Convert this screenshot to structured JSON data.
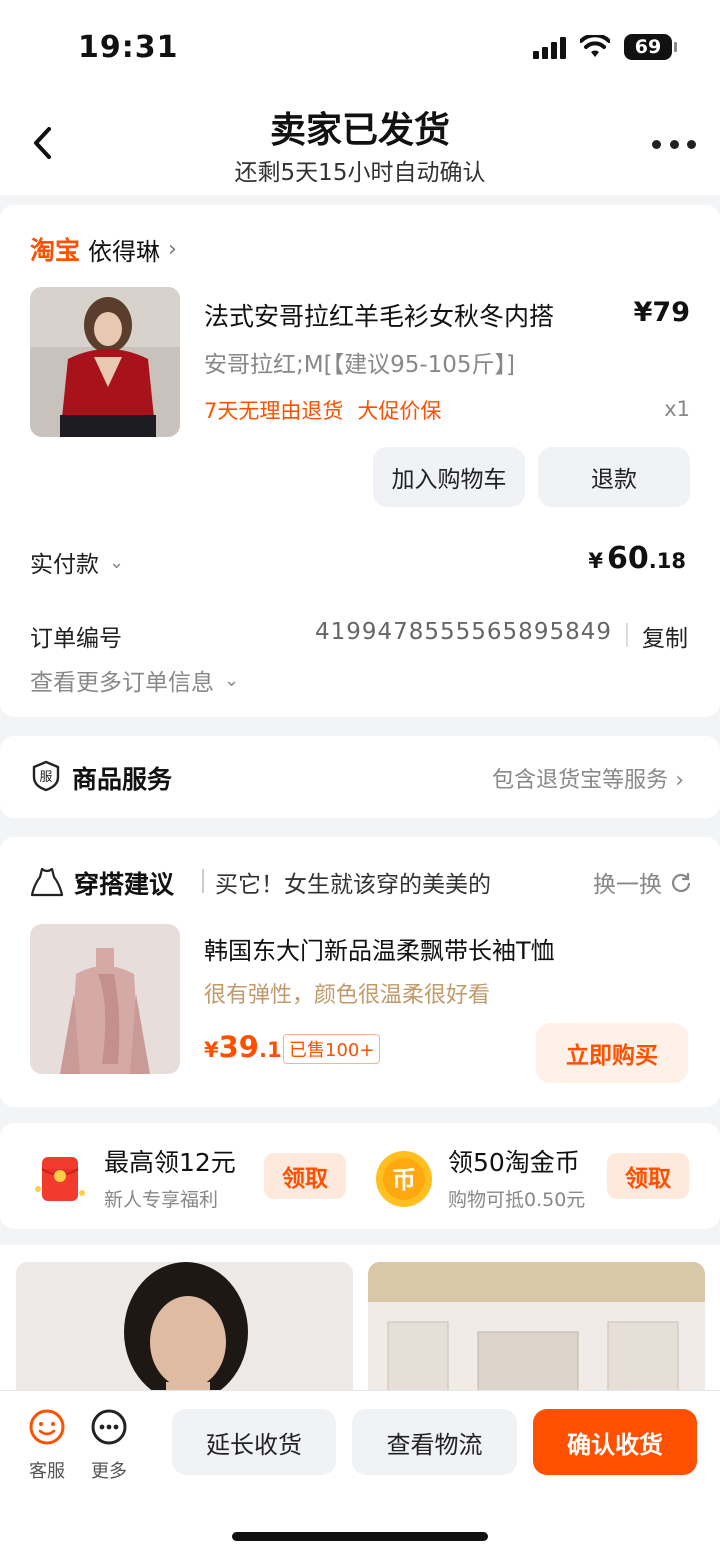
{
  "status_bar": {
    "time": "19:31",
    "battery": "69"
  },
  "nav": {
    "title": "卖家已发货",
    "subtitle": "还剩5天15小时自动确认"
  },
  "order": {
    "shop_logo": "淘宝",
    "shop_name": "依得琳",
    "product": {
      "title": "法式安哥拉红羊毛衫女秋冬内搭",
      "price": "¥79",
      "spec": "安哥拉红;M[【建议95-105斤】]",
      "tags": [
        "7天无理由退货",
        "大促价保"
      ],
      "quantity": "x1"
    },
    "buttons": {
      "add_cart": "加入购物车",
      "refund": "退款"
    },
    "paid_label": "实付款",
    "paid_currency": "¥",
    "paid_int": "60",
    "paid_dec": ".18",
    "order_no_label": "订单编号",
    "order_no": "4199478555565895849",
    "copy_label": "复制",
    "more_info": "查看更多订单信息"
  },
  "service": {
    "title": "商品服务",
    "desc": "包含退货宝等服务"
  },
  "outfit": {
    "title": "穿搭建议",
    "slogan": "买它！女生就该穿的美美的",
    "refresh": "换一换",
    "item": {
      "title": "韩国东大门新品温柔飘带长袖T恤",
      "desc": "很有弹性，颜色很温柔很好看",
      "price_currency": "¥",
      "price_int": "39",
      "price_dec": ".1",
      "sold": "已售100+",
      "buy": "立即购买"
    }
  },
  "promos": [
    {
      "title": "最高领12元",
      "sub": "新人专享福利",
      "btn": "领取",
      "icon": "red-envelope-icon"
    },
    {
      "title": "领50淘金币",
      "sub": "购物可抵0.50元",
      "btn": "领取",
      "icon": "gold-coin-icon"
    }
  ],
  "bottom": {
    "service_label": "客服",
    "more_label": "更多",
    "extend": "延长收货",
    "logistics": "查看物流",
    "confirm": "确认收货"
  },
  "colors": {
    "accent": "#ff5000",
    "brand_light": "#fff1e8",
    "gray_button": "#f0f2f5"
  }
}
